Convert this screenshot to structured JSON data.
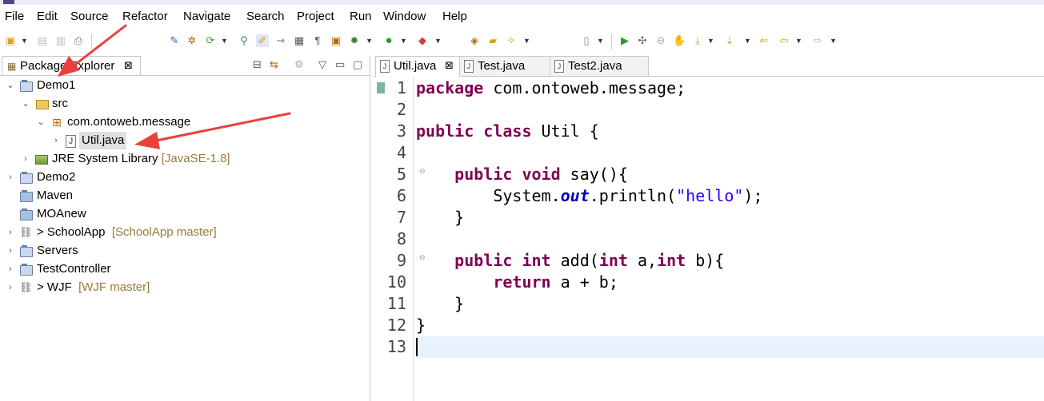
{
  "menu": [
    "File",
    "Edit",
    "Source",
    "Refactor",
    "Navigate",
    "Search",
    "Project",
    "Run",
    "Window",
    "Help"
  ],
  "left_view": {
    "title": "Package Explorer",
    "close": "⊠"
  },
  "tree": [
    {
      "label": "Demo1",
      "decoration": "",
      "expanded": true,
      "level": 0,
      "kind": "project"
    },
    {
      "label": "src",
      "decoration": "",
      "expanded": true,
      "level": 1,
      "kind": "source-folder"
    },
    {
      "label": "com.ontoweb.message",
      "decoration": "",
      "expanded": true,
      "level": 2,
      "kind": "package"
    },
    {
      "label": "Util.java",
      "decoration": "",
      "expanded": false,
      "level": 3,
      "kind": "java-file",
      "selected": true
    },
    {
      "label": "JRE System Library",
      "decoration": "[JavaSE-1.8]",
      "expanded": false,
      "level": 1,
      "kind": "library"
    },
    {
      "label": "Demo2",
      "decoration": "",
      "expanded": false,
      "level": 0,
      "kind": "project"
    },
    {
      "label": "Maven",
      "decoration": "",
      "expanded": false,
      "level": 0,
      "kind": "folder"
    },
    {
      "label": "MOAnew",
      "decoration": "",
      "expanded": false,
      "level": 0,
      "kind": "folder"
    },
    {
      "label": "> SchoolApp",
      "decoration": "[SchoolApp master]",
      "expanded": false,
      "level": 0,
      "kind": "git-project"
    },
    {
      "label": "Servers",
      "decoration": "",
      "expanded": false,
      "level": 0,
      "kind": "project"
    },
    {
      "label": "TestController",
      "decoration": "",
      "expanded": false,
      "level": 0,
      "kind": "project"
    },
    {
      "label": "> WJF",
      "decoration": "[WJF master]",
      "expanded": false,
      "level": 0,
      "kind": "git-project"
    }
  ],
  "editor": {
    "tabs": [
      {
        "label": "Util.java",
        "active": true,
        "close": "⊠"
      },
      {
        "label": "Test.java",
        "active": false,
        "close": ""
      },
      {
        "label": "Test2.java",
        "active": false,
        "close": ""
      }
    ],
    "line_numbers": [
      "1",
      "2",
      "3",
      "4",
      "5",
      "6",
      "7",
      "8",
      "9",
      "10",
      "11",
      "12",
      "13"
    ],
    "current_line": 13
  },
  "code": {
    "l1_kw": "package",
    "l1_rest": " com.ontoweb.message;",
    "l3_kw1": "public",
    "l3_kw2": "class",
    "l3_rest": " Util {",
    "l5_indent": "    ",
    "l5_kw1": "public",
    "l5_kw2": "void",
    "l5_rest": " say(){",
    "l6_pre": "        System.",
    "l6_field": "out",
    "l6_mid": ".println(",
    "l6_str": "\"hello\"",
    "l6_post": ");",
    "l7": "    }",
    "l9_indent": "    ",
    "l9_kw1": "public",
    "l9_kw2": "int",
    "l9_mid": " add(",
    "l9_kw3": "int",
    "l9_mid2": " a,",
    "l9_kw4": "int",
    "l9_post": " b){",
    "l10_indent": "        ",
    "l10_kw": "return",
    "l10_rest": " a + b;",
    "l11": "    }",
    "l12": "}"
  },
  "colors": {
    "keyword": "#7f0055",
    "string": "#2a00ff",
    "field": "#0000c0",
    "current_line": "#e8f2fe",
    "arrow": "#e8413b"
  }
}
